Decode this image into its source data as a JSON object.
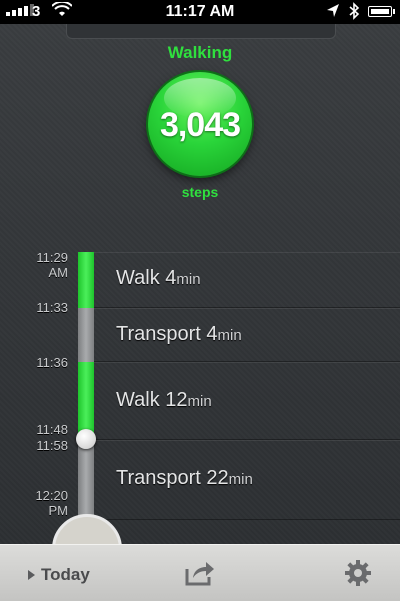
{
  "status_bar": {
    "carrier": "3",
    "time": "11:17 AM"
  },
  "summary": {
    "activity": "Walking",
    "steps": "3,043",
    "steps_unit": "steps"
  },
  "timeline": {
    "time_labels": [
      {
        "line1": "11:29",
        "line2": "AM"
      },
      {
        "line1": "11:33",
        "line2": ""
      },
      {
        "line1": "11:36",
        "line2": ""
      },
      {
        "line1": "11:48",
        "line2": ""
      },
      {
        "line1": "11:58",
        "line2": ""
      },
      {
        "line1": "12:20",
        "line2": "PM"
      }
    ],
    "segments": [
      {
        "name": "Walk",
        "duration": "4",
        "unit": "min",
        "type": "walk"
      },
      {
        "name": "Transport",
        "duration": "4",
        "unit": "min",
        "type": "transport"
      },
      {
        "name": "Walk",
        "duration": "12",
        "unit": "min",
        "type": "walk"
      },
      {
        "name": "Transport",
        "duration": "22",
        "unit": "min",
        "type": "transport"
      }
    ]
  },
  "toolbar": {
    "today_label": "Today",
    "icons": [
      "play-triangle-icon",
      "share-icon",
      "gear-icon"
    ]
  },
  "colors": {
    "accent_green": "#2fe03e",
    "transport_gray": "#9a9c9e"
  }
}
